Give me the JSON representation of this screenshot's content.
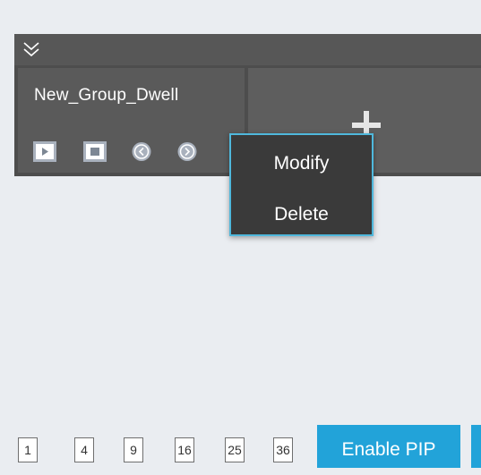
{
  "toolbar": {
    "collapse_icon": "double-chevron-down-icon"
  },
  "group": {
    "name": "New_Group_Dwell",
    "controls": [
      "play-icon",
      "stop-icon",
      "previous-icon",
      "next-icon"
    ]
  },
  "add_panel": {
    "icon": "plus-icon"
  },
  "context_menu": {
    "items": [
      "Modify",
      "Delete"
    ]
  },
  "bottom": {
    "split_options": [
      "1",
      "4",
      "9",
      "16",
      "25",
      "36"
    ],
    "pip_label": "Enable PIP"
  },
  "colors": {
    "accent": "#22a3d9",
    "menu_border": "#4fb8dc",
    "dark_panel": "#4d4d4d"
  }
}
